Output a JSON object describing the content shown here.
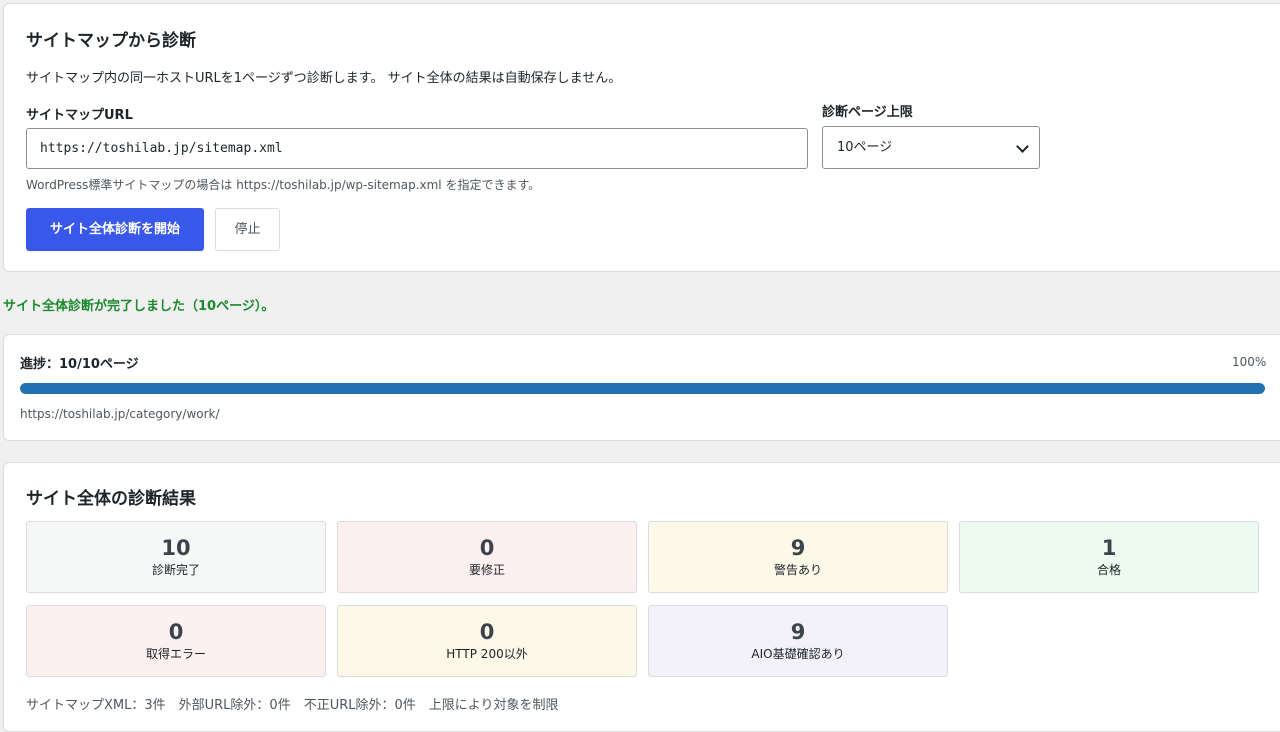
{
  "sitemap_section": {
    "title": "サイトマップから診断",
    "description": "サイトマップ内の同一ホストURLを1ページずつ診断します。 サイト全体の結果は自動保存しません。",
    "url_label": "サイトマップURL",
    "url_value": "https://toshilab.jp/sitemap.xml",
    "limit_label": "診断ページ上限",
    "limit_selected": "10ページ",
    "hint": "WordPress標準サイトマップの場合は https://toshilab.jp/wp-sitemap.xml を指定できます。",
    "start_button": "サイト全体診断を開始",
    "stop_button": "停止"
  },
  "notice": "サイト全体診断が完了しました（10ページ）。",
  "progress": {
    "label": "進捗：10/10ページ",
    "percent_text": "100%",
    "percent": 100,
    "current_url": "https://toshilab.jp/category/work/"
  },
  "results": {
    "title": "サイト全体の診断結果",
    "cards": [
      {
        "value": "10",
        "label": "診断完了",
        "color": "#f6f7f7"
      },
      {
        "value": "0",
        "label": "要修正",
        "color": "#fcf0f1"
      },
      {
        "value": "9",
        "label": "警告あり",
        "color": "#fcf9e8"
      },
      {
        "value": "1",
        "label": "合格",
        "color": "#edfaef"
      },
      {
        "value": "0",
        "label": "取得エラー",
        "color": "#fcf0f1"
      },
      {
        "value": "0",
        "label": "HTTP 200以外",
        "color": "#fcf9e8"
      },
      {
        "value": "9",
        "label": "AIO基礎確認あり",
        "color": "#f3f1fa"
      }
    ],
    "footer": "サイトマップXML：3件　外部URL除外：0件　不正URL除外：0件　上限により対象を制限"
  },
  "colors": {
    "primary_button": "#3858e9",
    "progress_bar": "#2271b1",
    "success_text": "#1a8a2c"
  }
}
